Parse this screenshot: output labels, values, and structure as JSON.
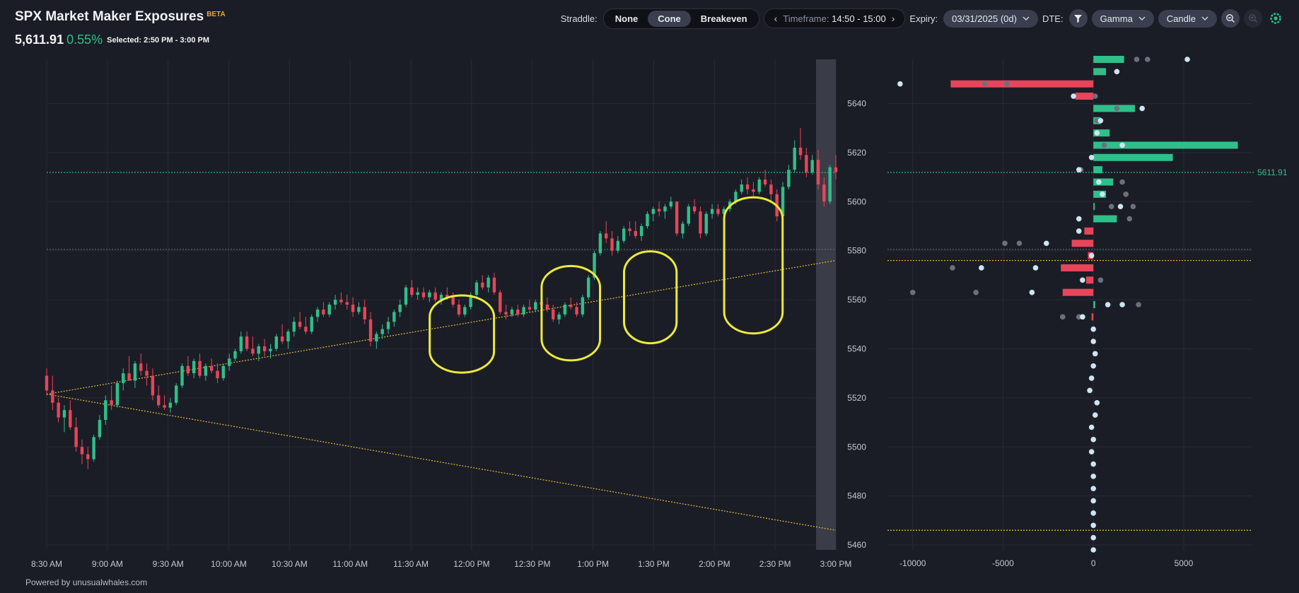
{
  "header": {
    "symbol": "SPX",
    "title": "Market Maker Exposures",
    "beta": "BETA",
    "price": "5,611.91",
    "change": "0.55%",
    "selected": "Selected: 2:50 PM - 3:00 PM"
  },
  "toolbar": {
    "straddle_label": "Straddle:",
    "straddle_options": [
      "None",
      "Cone",
      "Breakeven"
    ],
    "straddle_active": "Cone",
    "timeframe_label": "Timeframe:",
    "timeframe_value": "14:50 - 15:00",
    "expiry_label": "Expiry:",
    "expiry_value": "03/31/2025 (0d)",
    "dte_label": "DTE:",
    "greek_value": "Gamma",
    "chart_type_value": "Candle",
    "icons": [
      "filter-icon",
      "zoom-out-icon",
      "zoom-in-icon",
      "gear-icon"
    ],
    "accent": "#2fbf8a"
  },
  "footer": {
    "text": "Powered by unusualwhales.com"
  },
  "colors": {
    "up": "#2fbf8a",
    "down": "#e8455a",
    "cone": "#e2b93b",
    "highlight": "#ecea3a",
    "current": "#2fbf8a",
    "dot": "#cfe4f2",
    "dot_dim": "#6b707d"
  },
  "chart_data": [
    {
      "type": "candlestick",
      "time_labels": [
        "8:30 AM",
        "9:00 AM",
        "9:30 AM",
        "10:00 AM",
        "10:30 AM",
        "11:00 AM",
        "11:30 AM",
        "12:00 PM",
        "12:30 PM",
        "1:00 PM",
        "1:30 PM",
        "2:00 PM",
        "2:30 PM",
        "3:00 PM"
      ],
      "price_range": [
        5458,
        5658
      ],
      "current_price": 5611.91,
      "reference_level": 5580.5,
      "cone": {
        "start": 5521.5,
        "upper_end": 5576,
        "lower_end": 5466
      },
      "candles": [
        [
          5529,
          5532,
          5521,
          5523
        ],
        [
          5523,
          5529,
          5515,
          5518
        ],
        [
          5518,
          5520,
          5510,
          5512
        ],
        [
          5512,
          5517,
          5506,
          5515
        ],
        [
          5515,
          5519,
          5507,
          5508
        ],
        [
          5508,
          5512,
          5498,
          5500
        ],
        [
          5500,
          5503,
          5493,
          5497
        ],
        [
          5497,
          5500,
          5491,
          5495
        ],
        [
          5495,
          5505,
          5494,
          5504
        ],
        [
          5504,
          5513,
          5503,
          5511
        ],
        [
          5511,
          5521,
          5509,
          5519
        ],
        [
          5519,
          5525,
          5515,
          5517
        ],
        [
          5517,
          5527,
          5516,
          5526
        ],
        [
          5526,
          5532,
          5523,
          5530
        ],
        [
          5530,
          5537,
          5528,
          5527
        ],
        [
          5527,
          5535,
          5524,
          5534
        ],
        [
          5534,
          5538,
          5529,
          5531
        ],
        [
          5531,
          5534,
          5525,
          5529
        ],
        [
          5529,
          5532,
          5519,
          5521
        ],
        [
          5521,
          5525,
          5516,
          5517
        ],
        [
          5517,
          5521,
          5515,
          5516
        ],
        [
          5516,
          5520,
          5514,
          5518
        ],
        [
          5518,
          5526,
          5517,
          5525
        ],
        [
          5525,
          5534,
          5524,
          5533
        ],
        [
          5533,
          5537,
          5529,
          5530
        ],
        [
          5530,
          5536,
          5528,
          5535
        ],
        [
          5535,
          5538,
          5528,
          5529
        ],
        [
          5529,
          5534,
          5527,
          5533
        ],
        [
          5533,
          5536,
          5530,
          5531
        ],
        [
          5531,
          5534,
          5526,
          5528
        ],
        [
          5528,
          5534,
          5527,
          5533
        ],
        [
          5533,
          5538,
          5531,
          5536
        ],
        [
          5536,
          5540,
          5535,
          5539
        ],
        [
          5539,
          5547,
          5538,
          5545
        ],
        [
          5545,
          5547,
          5539,
          5540
        ],
        [
          5540,
          5545,
          5537,
          5538
        ],
        [
          5538,
          5542,
          5535,
          5541
        ],
        [
          5541,
          5544,
          5537,
          5539
        ],
        [
          5539,
          5542,
          5536,
          5540
        ],
        [
          5540,
          5546,
          5539,
          5545
        ],
        [
          5545,
          5550,
          5542,
          5543
        ],
        [
          5543,
          5548,
          5540,
          5547
        ],
        [
          5547,
          5553,
          5545,
          5551
        ],
        [
          5551,
          5555,
          5548,
          5549
        ],
        [
          5549,
          5553,
          5546,
          5547
        ],
        [
          5547,
          5554,
          5546,
          5553
        ],
        [
          5553,
          5557,
          5551,
          5556
        ],
        [
          5556,
          5559,
          5553,
          5554
        ],
        [
          5554,
          5559,
          5553,
          5558
        ],
        [
          5558,
          5562,
          5556,
          5560
        ],
        [
          5560,
          5563,
          5558,
          5559
        ],
        [
          5559,
          5562,
          5556,
          5558
        ],
        [
          5558,
          5561,
          5553,
          5555
        ],
        [
          5555,
          5559,
          5554,
          5557
        ],
        [
          5557,
          5560,
          5550,
          5552
        ],
        [
          5552,
          5555,
          5541,
          5543
        ],
        [
          5543,
          5547,
          5540,
          5546
        ],
        [
          5546,
          5550,
          5544,
          5548
        ],
        [
          5548,
          5553,
          5546,
          5551
        ],
        [
          5551,
          5556,
          5549,
          5555
        ],
        [
          5555,
          5560,
          5553,
          5558
        ],
        [
          5558,
          5566,
          5557,
          5565
        ],
        [
          5565,
          5568,
          5561,
          5562
        ],
        [
          5562,
          5565,
          5560,
          5563
        ],
        [
          5563,
          5565,
          5560,
          5561
        ],
        [
          5561,
          5564,
          5559,
          5563
        ],
        [
          5563,
          5565,
          5559,
          5560
        ],
        [
          5560,
          5563,
          5558,
          5562
        ],
        [
          5562,
          5565,
          5560,
          5561
        ],
        [
          5561,
          5563,
          5557,
          5558
        ],
        [
          5558,
          5560,
          5553,
          5554
        ],
        [
          5554,
          5558,
          5553,
          5557
        ],
        [
          5557,
          5563,
          5556,
          5562
        ],
        [
          5562,
          5568,
          5561,
          5567
        ],
        [
          5567,
          5570,
          5564,
          5565
        ],
        [
          5565,
          5570,
          5563,
          5569
        ],
        [
          5569,
          5571,
          5562,
          5563
        ],
        [
          5563,
          5564,
          5554,
          5555
        ],
        [
          5555,
          5558,
          5552,
          5554
        ],
        [
          5554,
          5557,
          5553,
          5556
        ],
        [
          5556,
          5558,
          5553,
          5554
        ],
        [
          5554,
          5558,
          5553,
          5557
        ],
        [
          5557,
          5560,
          5555,
          5556
        ],
        [
          5556,
          5560,
          5555,
          5559
        ],
        [
          5559,
          5562,
          5557,
          5558
        ],
        [
          5558,
          5561,
          5555,
          5556
        ],
        [
          5556,
          5558,
          5551,
          5552
        ],
        [
          5552,
          5555,
          5550,
          5554
        ],
        [
          5554,
          5559,
          5553,
          5558
        ],
        [
          5558,
          5561,
          5556,
          5557
        ],
        [
          5557,
          5559,
          5553,
          5554
        ],
        [
          5554,
          5562,
          5553,
          5561
        ],
        [
          5561,
          5570,
          5560,
          5569
        ],
        [
          5569,
          5580,
          5568,
          5579
        ],
        [
          5579,
          5588,
          5578,
          5587
        ],
        [
          5587,
          5592,
          5583,
          5585
        ],
        [
          5585,
          5588,
          5578,
          5580
        ],
        [
          5580,
          5586,
          5579,
          5584
        ],
        [
          5584,
          5590,
          5583,
          5589
        ],
        [
          5589,
          5592,
          5586,
          5588
        ],
        [
          5588,
          5592,
          5585,
          5586
        ],
        [
          5586,
          5591,
          5584,
          5590
        ],
        [
          5590,
          5596,
          5589,
          5595
        ],
        [
          5595,
          5598,
          5592,
          5597
        ],
        [
          5597,
          5600,
          5594,
          5596
        ],
        [
          5596,
          5599,
          5593,
          5598
        ],
        [
          5598,
          5602,
          5597,
          5600
        ],
        [
          5600,
          5600,
          5586,
          5587
        ],
        [
          5587,
          5592,
          5585,
          5591
        ],
        [
          5591,
          5599,
          5590,
          5598
        ],
        [
          5598,
          5601,
          5595,
          5596
        ],
        [
          5596,
          5598,
          5585,
          5587
        ],
        [
          5587,
          5596,
          5586,
          5595
        ],
        [
          5595,
          5599,
          5593,
          5597
        ],
        [
          5597,
          5599,
          5594,
          5595
        ],
        [
          5595,
          5598,
          5593,
          5597
        ],
        [
          5597,
          5601,
          5596,
          5600
        ],
        [
          5600,
          5605,
          5599,
          5604
        ],
        [
          5604,
          5609,
          5603,
          5607
        ],
        [
          5607,
          5610,
          5603,
          5605
        ],
        [
          5605,
          5608,
          5602,
          5604
        ],
        [
          5604,
          5610,
          5603,
          5609
        ],
        [
          5609,
          5613,
          5606,
          5607
        ],
        [
          5607,
          5609,
          5600,
          5603
        ],
        [
          5603,
          5605,
          5592,
          5594
        ],
        [
          5594,
          5608,
          5593,
          5606
        ],
        [
          5606,
          5615,
          5605,
          5613
        ],
        [
          5613,
          5625,
          5612,
          5622
        ],
        [
          5622,
          5630,
          5617,
          5619
        ],
        [
          5619,
          5622,
          5610,
          5612
        ],
        [
          5612,
          5619,
          5611,
          5617
        ],
        [
          5617,
          5621,
          5605,
          5607
        ],
        [
          5607,
          5610,
          5598,
          5600
        ],
        [
          5600,
          5615,
          5599,
          5614
        ],
        [
          5614,
          5619,
          5609,
          5612
        ]
      ]
    },
    {
      "type": "horizontal_bar_with_dots",
      "strike_labels": [
        5460,
        5480,
        5500,
        5520,
        5540,
        5560,
        5580,
        5600,
        5620,
        5640
      ],
      "x_tick_labels": [
        -10000,
        -5000,
        0,
        5000
      ],
      "x_range": [
        -11400,
        8800
      ],
      "strike_range": [
        5458,
        5658
      ],
      "current_price_label": "5611.91",
      "bars": [
        [
          5658,
          1700
        ],
        [
          5653,
          700
        ],
        [
          5648,
          -7900
        ],
        [
          5643,
          -1000
        ],
        [
          5638,
          2300
        ],
        [
          5633,
          400
        ],
        [
          5628,
          900
        ],
        [
          5623,
          8000
        ],
        [
          5618,
          4400
        ],
        [
          5613,
          500
        ],
        [
          5608,
          1100
        ],
        [
          5603,
          700
        ],
        [
          5598,
          0
        ],
        [
          5593,
          1300
        ],
        [
          5588,
          -500
        ],
        [
          5583,
          -1200
        ],
        [
          5578,
          -300
        ],
        [
          5573,
          -1800
        ],
        [
          5568,
          -400
        ],
        [
          5563,
          -1700
        ],
        [
          5558,
          100
        ],
        [
          5553,
          -100
        ]
      ],
      "dots": [
        [
          5658,
          2400,
          0
        ],
        [
          5658,
          3000,
          0
        ],
        [
          5658,
          5200,
          1
        ],
        [
          5653,
          1300,
          1
        ],
        [
          5648,
          -10700,
          1
        ],
        [
          5648,
          -6000,
          0
        ],
        [
          5648,
          -4800,
          0
        ],
        [
          5643,
          -1100,
          1
        ],
        [
          5643,
          100,
          0
        ],
        [
          5638,
          1300,
          0
        ],
        [
          5638,
          2700,
          1
        ],
        [
          5633,
          200,
          0
        ],
        [
          5633,
          400,
          1
        ],
        [
          5628,
          200,
          1
        ],
        [
          5623,
          600,
          0
        ],
        [
          5623,
          1600,
          1
        ],
        [
          5618,
          -100,
          1
        ],
        [
          5613,
          -700,
          0
        ],
        [
          5613,
          -800,
          1
        ],
        [
          5608,
          300,
          1
        ],
        [
          5608,
          1600,
          0
        ],
        [
          5603,
          500,
          1
        ],
        [
          5603,
          1800,
          0
        ],
        [
          5598,
          1000,
          0
        ],
        [
          5598,
          1500,
          1
        ],
        [
          5598,
          2200,
          0
        ],
        [
          5593,
          -800,
          1
        ],
        [
          5593,
          2000,
          0
        ],
        [
          5588,
          -800,
          1
        ],
        [
          5583,
          -4900,
          0
        ],
        [
          5583,
          -4100,
          0
        ],
        [
          5583,
          -2600,
          1
        ],
        [
          5578,
          -100,
          1
        ],
        [
          5573,
          -7800,
          0
        ],
        [
          5573,
          -6200,
          1
        ],
        [
          5573,
          -3200,
          1
        ],
        [
          5568,
          -600,
          1
        ],
        [
          5568,
          400,
          0
        ],
        [
          5563,
          -10000,
          0
        ],
        [
          5563,
          -6500,
          0
        ],
        [
          5563,
          -3400,
          1
        ],
        [
          5558,
          800,
          1
        ],
        [
          5558,
          1600,
          1
        ],
        [
          5558,
          2500,
          0
        ],
        [
          5553,
          -1700,
          0
        ],
        [
          5553,
          -800,
          0
        ],
        [
          5553,
          -600,
          1
        ],
        [
          5548,
          0,
          1
        ],
        [
          5543,
          0,
          1
        ],
        [
          5538,
          100,
          1
        ],
        [
          5533,
          0,
          1
        ],
        [
          5528,
          -100,
          1
        ],
        [
          5523,
          -200,
          1
        ],
        [
          5518,
          200,
          1
        ],
        [
          5513,
          100,
          1
        ],
        [
          5508,
          -100,
          1
        ],
        [
          5503,
          0,
          1
        ],
        [
          5498,
          -100,
          1
        ],
        [
          5493,
          0,
          1
        ],
        [
          5488,
          0,
          1
        ],
        [
          5483,
          0,
          1
        ],
        [
          5478,
          0,
          1
        ],
        [
          5473,
          0,
          1
        ],
        [
          5468,
          0,
          1
        ],
        [
          5463,
          0,
          1
        ],
        [
          5458,
          0,
          1
        ]
      ]
    }
  ]
}
